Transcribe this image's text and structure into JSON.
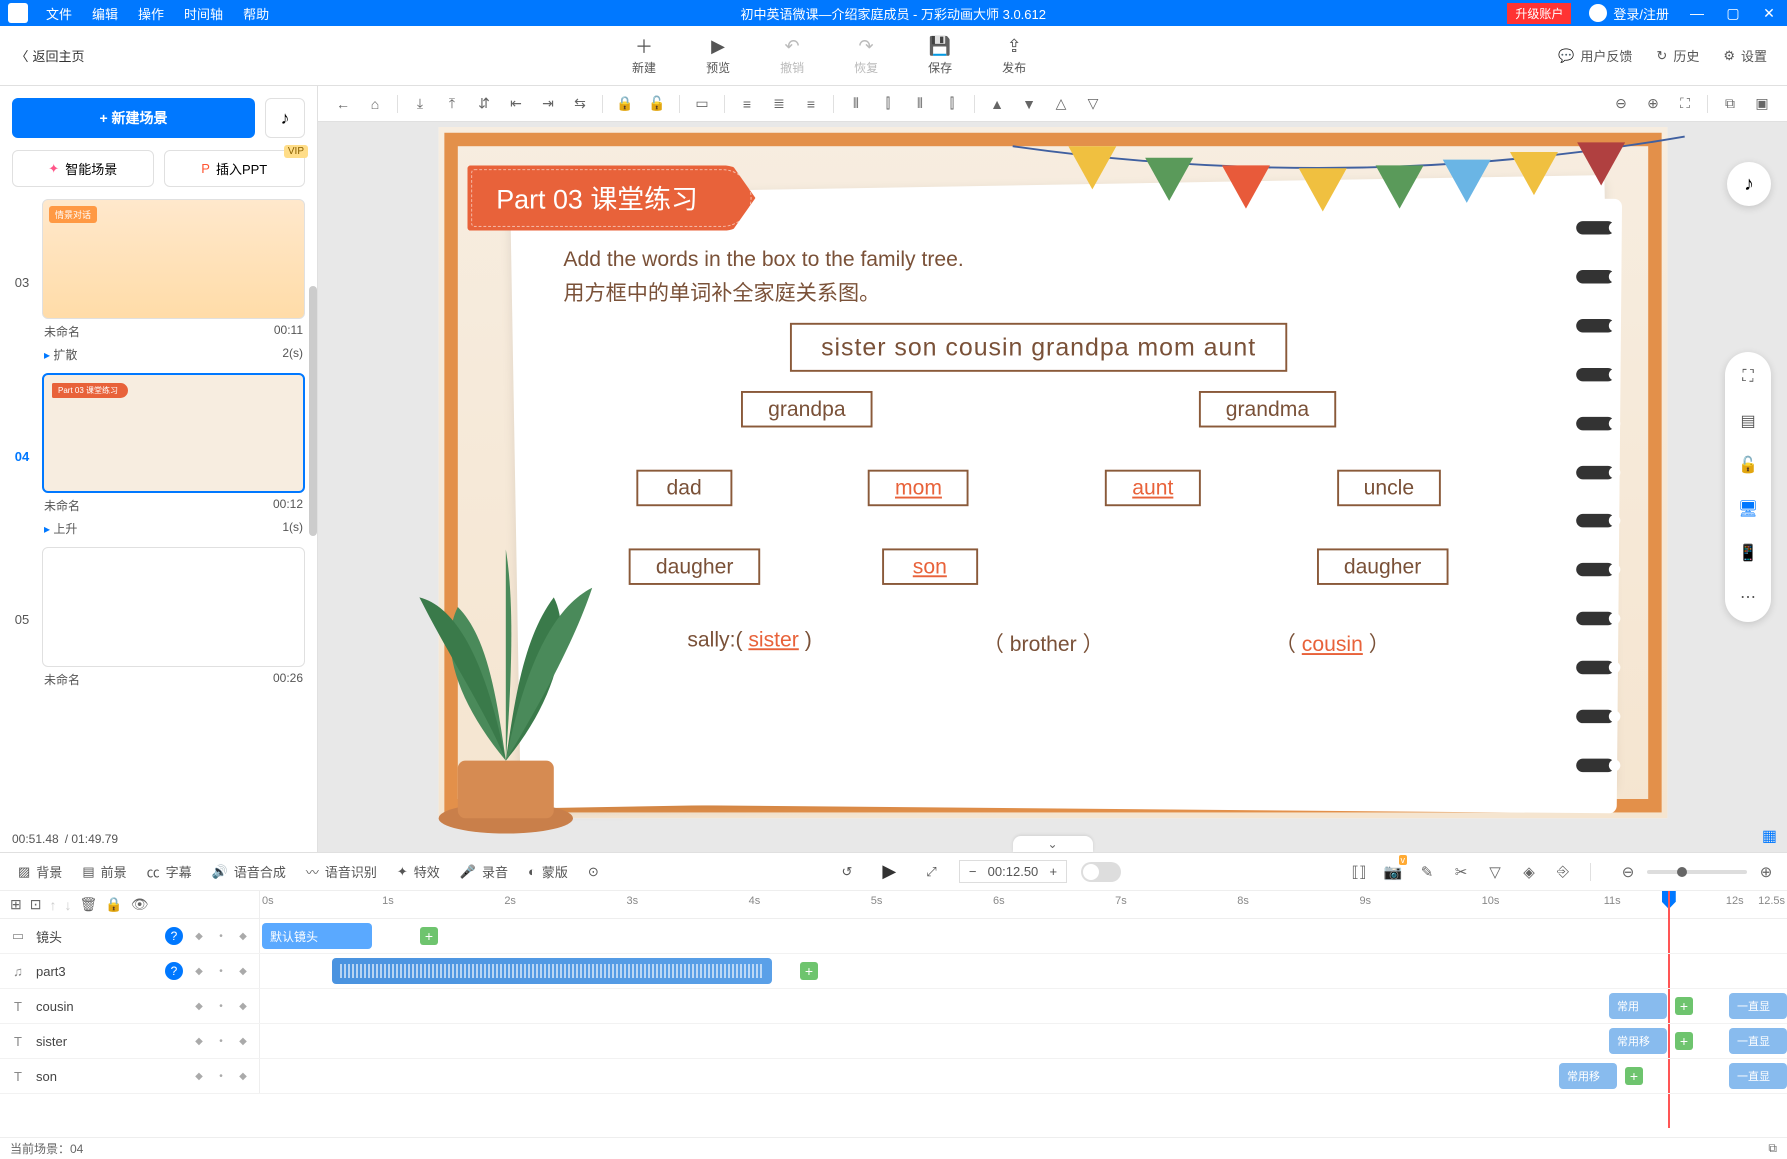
{
  "titlebar": {
    "menus": [
      "文件",
      "编辑",
      "操作",
      "时间轴",
      "帮助"
    ],
    "title": "初中英语微课—介绍家庭成员 - 万彩动画大师 3.0.612",
    "upgrade": "升级账户",
    "login": "登录/注册"
  },
  "back": "返回主页",
  "top_actions": {
    "new": "新建",
    "preview": "预览",
    "undo": "撤销",
    "redo": "恢复",
    "save": "保存",
    "publish": "发布"
  },
  "top_right": {
    "feedback": "用户反馈",
    "history": "历史",
    "settings": "设置"
  },
  "left": {
    "new_scene": "+  新建场景",
    "ai_scene": "智能场景",
    "insert_ppt": "插入PPT",
    "vip": "VIP",
    "scenes": [
      {
        "num": "03",
        "name": "未命名",
        "dur": "00:11",
        "effect": "扩散",
        "effect_time": "2(s)",
        "thumb_label": "情景对话"
      },
      {
        "num": "04",
        "name": "未命名",
        "dur": "00:12",
        "effect": "上升",
        "effect_time": "1(s)",
        "thumb_banner": "Part 03  课堂练习"
      },
      {
        "num": "05",
        "name": "未命名",
        "dur": "00:26"
      }
    ],
    "time_cur": "00:51.48",
    "time_total": "/ 01:49.79"
  },
  "canvas": {
    "cam_label": "默认镜头",
    "part_label": "Part 03  课堂练习",
    "instruction_en": "Add the words in the box to the family tree.",
    "instruction_cn": "用方框中的单词补全家庭关系图。",
    "wordbox": "sister   son   cousin   grandpa   mom   aunt",
    "nodes": {
      "grandpa": "grandpa",
      "grandma": "grandma",
      "dad": "dad",
      "mom": "mom",
      "aunt": "aunt",
      "uncle": "uncle",
      "daughter1": "daugher",
      "son": "son",
      "daughter2": "daugher",
      "sally": "sally:",
      "sister": "sister",
      "brother": "（ brother ）",
      "cousin": "cousin",
      "lp": "（",
      "rp": "）"
    }
  },
  "timeline_top": {
    "items": [
      "背景",
      "前景",
      "字幕",
      "语音合成",
      "语音识别",
      "特效",
      "录音",
      "蒙版"
    ],
    "time": "00:12.50"
  },
  "tracks": [
    {
      "type": "▭",
      "name": "镜头",
      "help": true,
      "clip": "默认镜头"
    },
    {
      "type": "♫",
      "name": "part3",
      "help": true
    },
    {
      "type": "T",
      "name": "cousin",
      "tag": "常用",
      "tag2": "一直显"
    },
    {
      "type": "T",
      "name": "sister",
      "tag": "常用移",
      "tag2": "一直显"
    },
    {
      "type": "T",
      "name": "son",
      "tag": "常用移",
      "tag2": "一直显"
    }
  ],
  "ruler": [
    "0s",
    "1s",
    "2s",
    "3s",
    "4s",
    "5s",
    "6s",
    "7s",
    "8s",
    "9s",
    "10s",
    "11s",
    "12s",
    "12.5s"
  ],
  "footer": {
    "scene": "当前场景：04"
  }
}
